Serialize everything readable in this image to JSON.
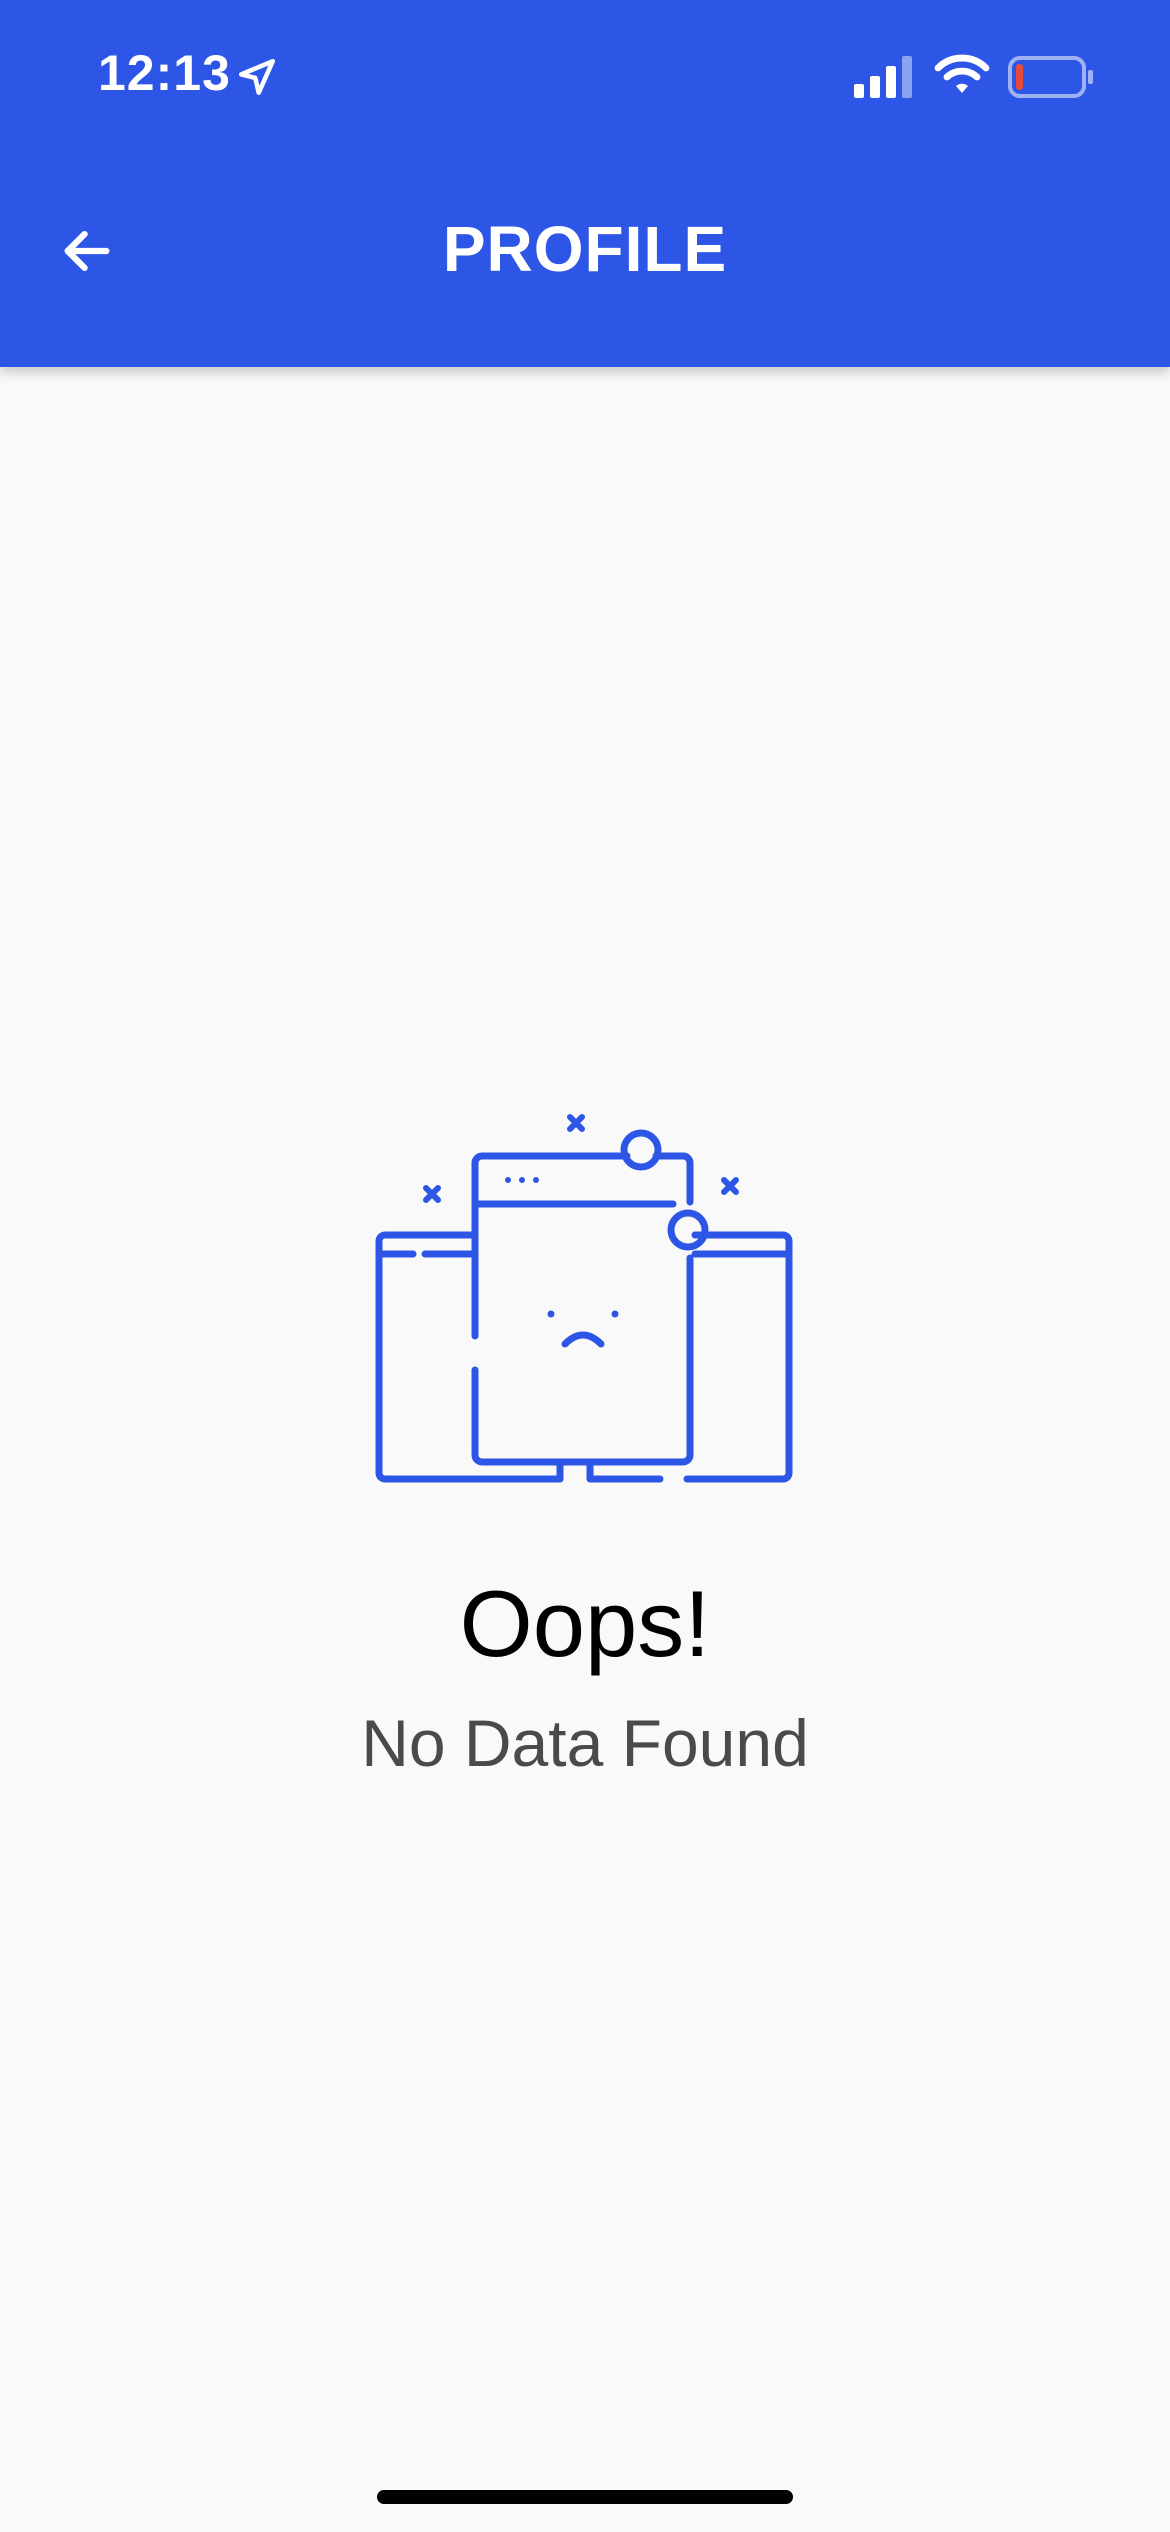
{
  "status_bar": {
    "time": "12:13",
    "icons": [
      "location-arrow-icon",
      "cellular-signal-icon",
      "wifi-icon",
      "battery-icon"
    ],
    "battery_level": 0.12
  },
  "header": {
    "title": "PROFILE",
    "back_icon": "arrow-left-icon"
  },
  "empty_state": {
    "illustration": "sad-window-icon",
    "title": "Oops!",
    "message": "No Data Found"
  },
  "colors": {
    "primary": "#2d56e6",
    "background": "#f9f9f9",
    "battery_low": "#e64a3b"
  }
}
